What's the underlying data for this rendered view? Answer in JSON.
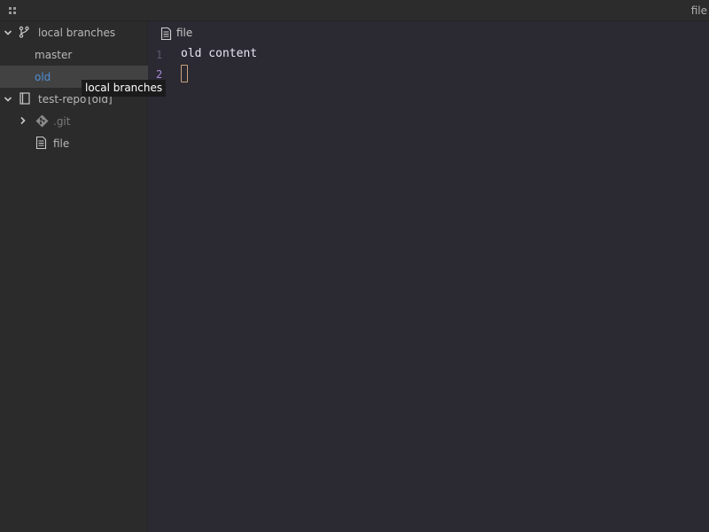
{
  "topbar": {
    "grid_icon": "grid-icon",
    "title": "file"
  },
  "sidebar": {
    "local_branches": {
      "label": "local branches",
      "icon": "git-branch-icon",
      "branches": [
        {
          "label": "master",
          "selected": false
        },
        {
          "label": "old",
          "selected": true,
          "color": "#4f8fd6"
        }
      ]
    },
    "repo": {
      "label": "test-repo",
      "branch_tag": "[old]",
      "icon": "repository-icon",
      "children": [
        {
          "label": ".git",
          "icon": "git-icon",
          "collapsed": true
        },
        {
          "label": "file",
          "icon": "file-icon"
        }
      ]
    }
  },
  "tooltip": {
    "text": "local branches"
  },
  "editor": {
    "tab_label": "file",
    "tab_icon": "file-icon",
    "lines": [
      {
        "number": "1",
        "text": "old content"
      },
      {
        "number": "2",
        "text": ""
      }
    ],
    "current_line": 2
  },
  "colors": {
    "background": "#2b2a33",
    "sidebar": "#2b2b2b",
    "selection": "#424242",
    "accent_branch": "#4f8fd6",
    "active_line_number": "#a98bd9",
    "cursor": "#c9a27a"
  }
}
